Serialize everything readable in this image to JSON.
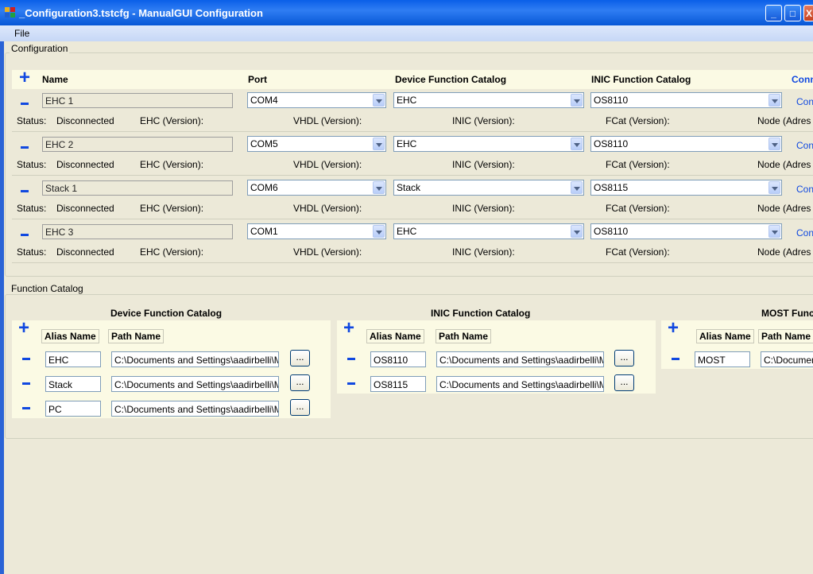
{
  "window": {
    "title": "_Configuration3.tstcfg - ManualGUI Configuration",
    "min_label": "_",
    "max_label": "□",
    "close_label": "X"
  },
  "menu": {
    "file": "File"
  },
  "configuration": {
    "label": "Configuration",
    "add_label": "+",
    "headers": {
      "name": "Name",
      "port": "Port",
      "device_catalog": "Device Function Catalog",
      "inic_catalog": "INIC Function Catalog",
      "connect": "Conn"
    },
    "status_labels": {
      "status": "Status:",
      "ehc": "EHC (Version):",
      "vhdl": "VHDL (Version):",
      "inic": "INIC (Version):",
      "fcat": "FCat (Version):",
      "node": "Node (Adres"
    },
    "rows": [
      {
        "name": "EHC 1",
        "port": "COM4",
        "device": "EHC",
        "inic": "OS8110",
        "connect": "Conn",
        "status": "Disconnected"
      },
      {
        "name": "EHC 2",
        "port": "COM5",
        "device": "EHC",
        "inic": "OS8110",
        "connect": "Conn",
        "status": "Disconnected"
      },
      {
        "name": "Stack 1",
        "port": "COM6",
        "device": "Stack",
        "inic": "OS8115",
        "connect": "Conn",
        "status": "Disconnected"
      },
      {
        "name": "EHC 3",
        "port": "COM1",
        "device": "EHC",
        "inic": "OS8110",
        "connect": "Conn",
        "status": "Disconnected"
      }
    ]
  },
  "function_catalog": {
    "label": "Function Catalog",
    "alias_header": "Alias Name",
    "path_header": "Path Name",
    "browse_label": "...",
    "device": {
      "title": "Device Function Catalog",
      "items": [
        {
          "alias": "EHC",
          "path": "C:\\Documents and Settings\\aadirbelli\\My"
        },
        {
          "alias": "Stack",
          "path": "C:\\Documents and Settings\\aadirbelli\\My"
        },
        {
          "alias": "PC",
          "path": "C:\\Documents and Settings\\aadirbelli\\My"
        }
      ]
    },
    "inic": {
      "title": "INIC Function Catalog",
      "items": [
        {
          "alias": "OS8110",
          "path": "C:\\Documents and Settings\\aadirbelli\\My"
        },
        {
          "alias": "OS8115",
          "path": "C:\\Documents and Settings\\aadirbelli\\My"
        }
      ]
    },
    "most": {
      "title": "MOST Func",
      "items": [
        {
          "alias": "MOST",
          "path": "C:\\Documen"
        }
      ]
    }
  },
  "colors": {
    "accent": "#1048e0",
    "titlebar": "#0a5fe8",
    "panel": "#fbfae4",
    "background": "#ece9d8"
  }
}
